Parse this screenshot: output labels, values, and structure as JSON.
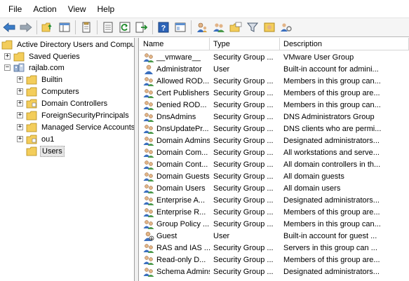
{
  "menu": [
    "File",
    "Action",
    "View",
    "Help"
  ],
  "toolbar": {
    "icons": [
      "back-icon",
      "forward-icon",
      "up-folder-icon",
      "show-hide-tree-icon",
      "copy-icon",
      "properties-icon",
      "refresh-icon",
      "export-list-icon",
      "help-icon",
      "console-icon",
      "users-icon",
      "new-group-icon",
      "new-ou-icon",
      "filter-icon",
      "add-to-group-icon",
      "delegate-icon"
    ]
  },
  "tree": {
    "root": "Active Directory Users and Comput",
    "items": [
      {
        "label": "Saved Queries",
        "expander": "+",
        "indent": 1
      },
      {
        "label": "rajlab.com",
        "expander": "−",
        "indent": 1
      },
      {
        "label": "Builtin",
        "expander": "+",
        "indent": 2
      },
      {
        "label": "Computers",
        "expander": "+",
        "indent": 2
      },
      {
        "label": "Domain Controllers",
        "expander": "+",
        "indent": 2
      },
      {
        "label": "ForeignSecurityPrincipals",
        "expander": "+",
        "indent": 2
      },
      {
        "label": "Managed Service Accounts",
        "expander": "+",
        "indent": 2
      },
      {
        "label": "ou1",
        "expander": "+",
        "indent": 2
      },
      {
        "label": "Users",
        "expander": "",
        "indent": 2,
        "selected": true
      }
    ]
  },
  "list": {
    "columns": [
      "Name",
      "Type",
      "Description"
    ],
    "rows": [
      {
        "name": "__vmware__",
        "type": "Security Group ...",
        "desc": "VMware User Group",
        "icon": "group"
      },
      {
        "name": "Administrator",
        "type": "User",
        "desc": "Built-in account for admini...",
        "icon": "user"
      },
      {
        "name": "Allowed ROD...",
        "type": "Security Group ...",
        "desc": "Members in this group can...",
        "icon": "group"
      },
      {
        "name": "Cert Publishers",
        "type": "Security Group ...",
        "desc": "Members of this group are...",
        "icon": "group"
      },
      {
        "name": "Denied ROD...",
        "type": "Security Group ...",
        "desc": "Members in this group can...",
        "icon": "group"
      },
      {
        "name": "DnsAdmins",
        "type": "Security Group ...",
        "desc": "DNS Administrators Group",
        "icon": "group"
      },
      {
        "name": "DnsUpdatePr...",
        "type": "Security Group ...",
        "desc": "DNS clients who are permi...",
        "icon": "group"
      },
      {
        "name": "Domain Admins",
        "type": "Security Group ...",
        "desc": "Designated administrators...",
        "icon": "group"
      },
      {
        "name": "Domain Com...",
        "type": "Security Group ...",
        "desc": "All workstations and serve...",
        "icon": "group"
      },
      {
        "name": "Domain Cont...",
        "type": "Security Group ...",
        "desc": "All domain controllers in th...",
        "icon": "group"
      },
      {
        "name": "Domain Guests",
        "type": "Security Group ...",
        "desc": "All domain guests",
        "icon": "group"
      },
      {
        "name": "Domain Users",
        "type": "Security Group ...",
        "desc": "All domain users",
        "icon": "group"
      },
      {
        "name": "Enterprise A...",
        "type": "Security Group ...",
        "desc": "Designated administrators...",
        "icon": "group"
      },
      {
        "name": "Enterprise R...",
        "type": "Security Group ...",
        "desc": "Members of this group are...",
        "icon": "group"
      },
      {
        "name": "Group Policy ...",
        "type": "Security Group ...",
        "desc": "Members in this group can...",
        "icon": "group"
      },
      {
        "name": "Guest",
        "type": "User",
        "desc": "Built-in account for guest ...",
        "icon": "user-disabled"
      },
      {
        "name": "RAS and IAS ...",
        "type": "Security Group ...",
        "desc": "Servers in this group can ...",
        "icon": "group"
      },
      {
        "name": "Read-only D...",
        "type": "Security Group ...",
        "desc": "Members of this group are...",
        "icon": "group"
      },
      {
        "name": "Schema Admins",
        "type": "Security Group ...",
        "desc": "Designated administrators...",
        "icon": "group"
      }
    ]
  }
}
